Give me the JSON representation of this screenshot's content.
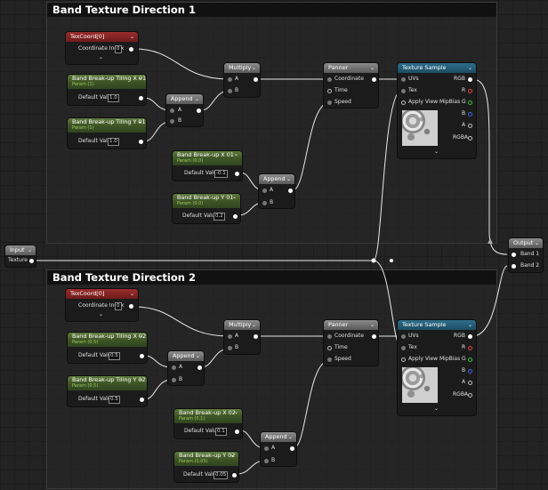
{
  "comments": {
    "dir1": "Band Texture Direction 1",
    "dir2": "Band Texture Direction 2"
  },
  "texcoord": {
    "title": "TexCoord[0]",
    "coord_label": "Coordinate Index",
    "value": "0"
  },
  "param1": {
    "tiling_x": {
      "title": "Band Break-up Tiling X 01",
      "sub": "Param (1)",
      "label": "Default Value",
      "value": "1.0"
    },
    "tiling_y": {
      "title": "Band Break-up Tiling Y 01",
      "sub": "Param (1)",
      "label": "Default Value",
      "value": "1.0"
    },
    "breakup_x": {
      "title": "Band Break-up X 01",
      "sub": "Param (0,0)",
      "label": "Default Value",
      "value": "-0.1"
    },
    "breakup_y": {
      "title": "Band Break-up Y 01",
      "sub": "Param (0,0)",
      "label": "Default Value",
      "value": "0.2"
    }
  },
  "param2": {
    "tiling_x": {
      "title": "Band Break-up Tiling X 02",
      "sub": "Param (0,5)",
      "label": "Default Value",
      "value": "0.5"
    },
    "tiling_y": {
      "title": "Band Break-up Tiling Y 02",
      "sub": "Param (0,5)",
      "label": "Default Value",
      "value": "0.5"
    },
    "breakup_x": {
      "title": "Band Break-up X 02",
      "sub": "Param (0,1)",
      "label": "Default Value",
      "value": "0.1"
    },
    "breakup_y": {
      "title": "Band Break-up Y 02",
      "sub": "Param (0,05)",
      "label": "Default Value",
      "value": "0.05"
    }
  },
  "append": {
    "title": "Append",
    "a": "A",
    "b": "B"
  },
  "multiply": {
    "title": "Multiply",
    "a": "A",
    "b": "B"
  },
  "panner": {
    "title": "Panner",
    "coordinate": "Coordinate",
    "time": "Time",
    "speed": "Speed"
  },
  "texture_sample": {
    "title": "Texture Sample",
    "uvs": "UVs",
    "tex": "Tex",
    "mipbias": "Apply View MipBias",
    "rgb": "RGB",
    "r": "R",
    "g": "G",
    "b": "B",
    "a": "A",
    "rgba": "RGBA"
  },
  "input": {
    "title": "Input",
    "texture": "Texture"
  },
  "output": {
    "title": "Output",
    "band1": "Band 1",
    "band2": "Band 2"
  },
  "colors": {
    "r": "#e04040",
    "g": "#40c040",
    "b": "#4060e0",
    "a": "#cccccc"
  }
}
